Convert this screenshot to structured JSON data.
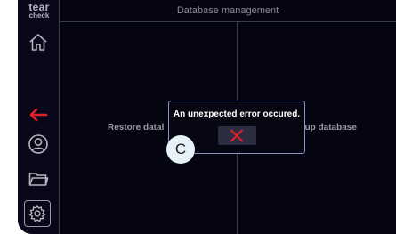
{
  "logo": {
    "line1": "tear",
    "line2": "check"
  },
  "sidebar": {
    "items": [
      {
        "name": "home",
        "icon": "home-icon"
      },
      {
        "name": "back",
        "icon": "arrow-left-icon",
        "color": "#e0202a"
      },
      {
        "name": "patient",
        "icon": "user-icon"
      },
      {
        "name": "files",
        "icon": "folder-icon"
      },
      {
        "name": "settings",
        "icon": "gear-icon"
      }
    ]
  },
  "header": {
    "title": "Database management"
  },
  "panes": {
    "left_label": "Restore datal",
    "right_label": "kup database"
  },
  "dialog": {
    "message": "An unexpected error occured.",
    "close_icon": "close-icon",
    "close_color": "#e0202a"
  },
  "hint": {
    "label": "C"
  }
}
